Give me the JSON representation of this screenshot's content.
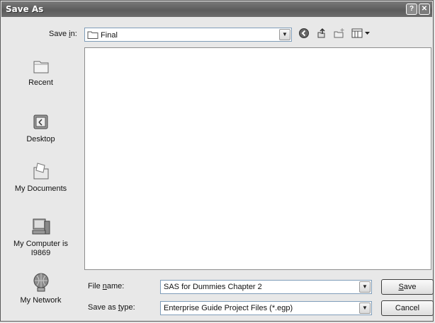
{
  "window": {
    "title": "Save As"
  },
  "titlebar": {
    "help_glyph": "?",
    "close_glyph": "✕"
  },
  "save_in": {
    "label_pre": "Save ",
    "label_mnemonic": "i",
    "label_post": "n:",
    "value": "Final",
    "icon": "folder-icon"
  },
  "toolbar": {
    "back_icon": "back-icon",
    "up_icon": "up-folder-icon",
    "new_folder_icon": "new-folder-icon",
    "views_icon": "views-menu-icon"
  },
  "places": [
    {
      "label": "Recent",
      "icon": "recent-folder-icon"
    },
    {
      "label": "Desktop",
      "icon": "desktop-icon"
    },
    {
      "label": "My Documents",
      "icon": "my-documents-icon"
    },
    {
      "label_line1": "My Computer is",
      "label_line2": "I9869",
      "icon": "my-computer-icon"
    },
    {
      "label": "My Network",
      "icon": "my-network-icon"
    }
  ],
  "file_name": {
    "label_pre": "File ",
    "label_mnemonic": "n",
    "label_post": "ame:",
    "value": "SAS for Dummies Chapter 2"
  },
  "save_as_type": {
    "label_pre": "Save as ",
    "label_mnemonic": "t",
    "label_post": "ype:",
    "value": "Enterprise Guide Project Files (*.egp)"
  },
  "buttons": {
    "save_mnemonic": "S",
    "save_rest": "ave",
    "cancel": "Cancel"
  }
}
